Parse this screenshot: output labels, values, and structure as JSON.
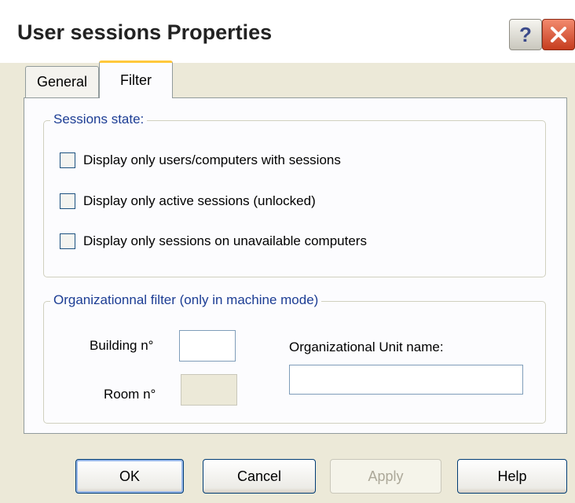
{
  "window": {
    "title": "User sessions Properties",
    "help_button": "?",
    "close_button": "close"
  },
  "tabs": [
    {
      "label": "General",
      "selected": false
    },
    {
      "label": "Filter",
      "selected": true
    }
  ],
  "sessions_state": {
    "legend": "Sessions state:",
    "options": [
      {
        "label": "Display only users/computers with sessions",
        "checked": false
      },
      {
        "label": "Display only active sessions (unlocked)",
        "checked": false
      },
      {
        "label": "Display only sessions on unavailable computers",
        "checked": false
      }
    ]
  },
  "org_filter": {
    "legend": "Organizationnal filter (only in machine mode)",
    "building_label": "Building n°",
    "building_value": "",
    "room_label": "Room n°",
    "room_value": "",
    "ou_label": "Organizational Unit name:",
    "ou_value": ""
  },
  "buttons": {
    "ok": "OK",
    "cancel": "Cancel",
    "apply": "Apply",
    "help": "Help"
  }
}
